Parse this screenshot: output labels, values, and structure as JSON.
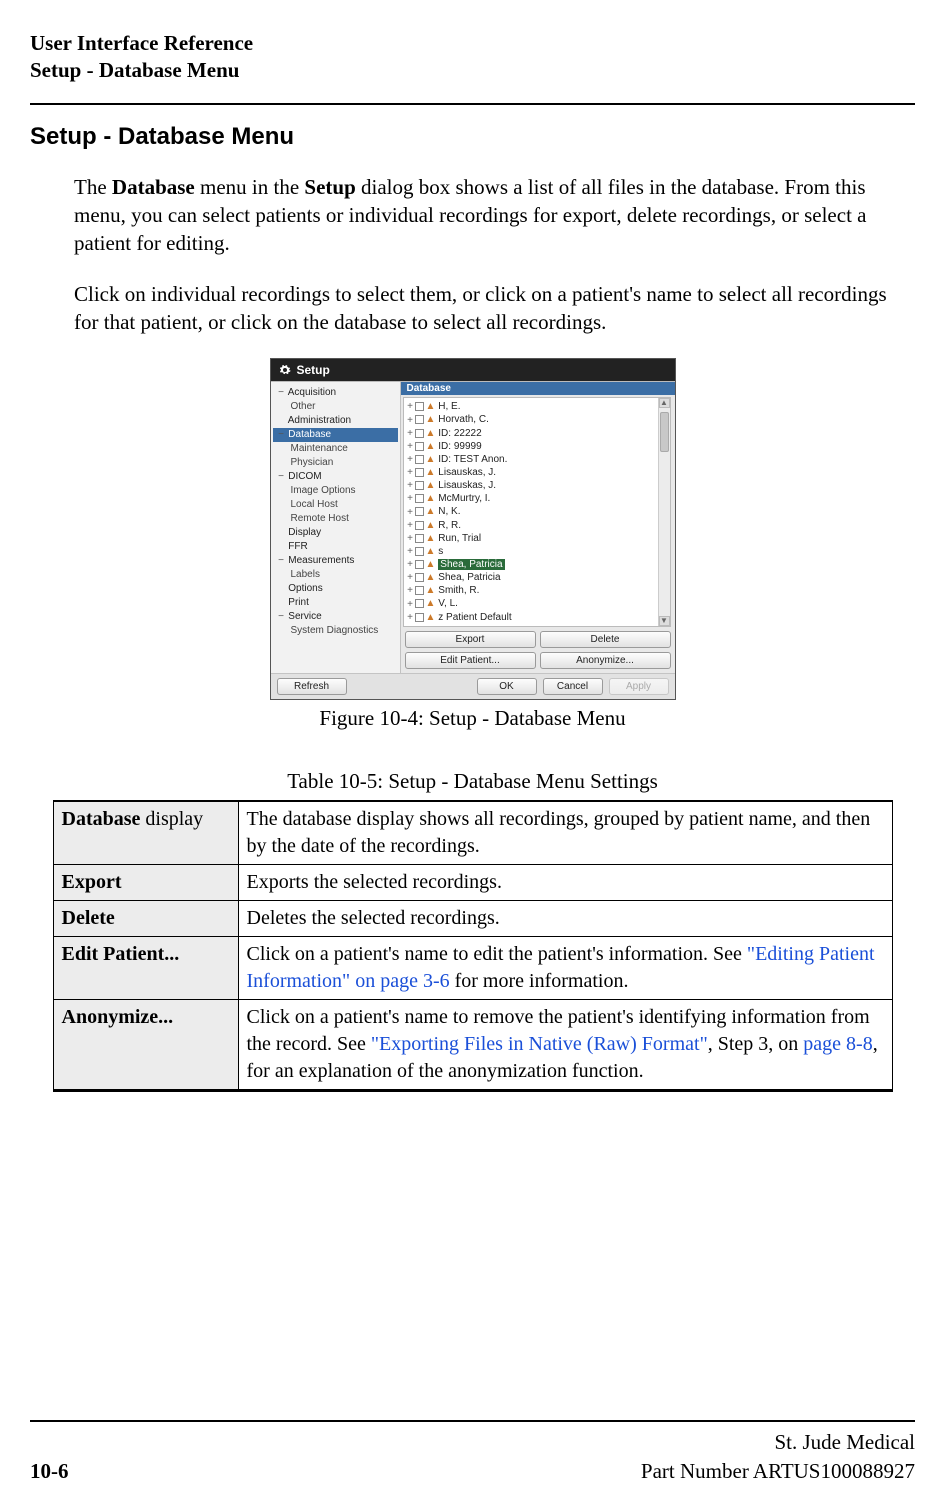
{
  "header": {
    "line1": "User Interface Reference",
    "line2": "Setup - Database Menu"
  },
  "h1": "Setup - Database Menu",
  "p1_pre": "The ",
  "p1_b1": "Database",
  "p1_mid": " menu in the ",
  "p1_b2": "Setup",
  "p1_post": " dialog box shows a list of all files in the database. From this menu, you can select patients or individual recordings for export, delete recordings, or select a patient for editing.",
  "p2": "Click on individual recordings to select them, or click on a patient's name to select all recordings for that patient, or click on the database to select all recordings.",
  "figure": {
    "caption": "Figure 10-4:  Setup - Database Menu",
    "dialog": {
      "title": "Setup",
      "nav": {
        "items": [
          {
            "label": "Acquisition",
            "level": 1,
            "exp": "−"
          },
          {
            "label": "Other",
            "level": 2
          },
          {
            "label": "Administration",
            "level": 1
          },
          {
            "label": "Database",
            "level": 1,
            "selected": true,
            "exp": "−"
          },
          {
            "label": "Maintenance",
            "level": 2
          },
          {
            "label": "Physician",
            "level": 2
          },
          {
            "label": "DICOM",
            "level": 1,
            "exp": "−"
          },
          {
            "label": "Image Options",
            "level": 2
          },
          {
            "label": "Local Host",
            "level": 2
          },
          {
            "label": "Remote Host",
            "level": 2
          },
          {
            "label": "Display",
            "level": 1
          },
          {
            "label": "FFR",
            "level": 1
          },
          {
            "label": "Measurements",
            "level": 1,
            "exp": "−"
          },
          {
            "label": "Labels",
            "level": 2
          },
          {
            "label": "Options",
            "level": 1
          },
          {
            "label": "Print",
            "level": 1
          },
          {
            "label": "Service",
            "level": 1,
            "exp": "−"
          },
          {
            "label": "System Diagnostics",
            "level": 2
          }
        ]
      },
      "db": {
        "heading": "Database",
        "patients": [
          "H, E.",
          "Horvath, C.",
          "ID: 22222",
          "ID: 99999",
          "ID: TEST Anon.",
          "Lisauskas, J.",
          "Lisauskas, J.",
          "McMurtry, I.",
          "N, K.",
          "R, R.",
          "Run, Trial",
          "s",
          "Shea, Patricia",
          "Shea, Patricia",
          "Smith, R.",
          "V, L.",
          "z Patient Default"
        ],
        "selected_index": 12
      },
      "actions": {
        "export": "Export",
        "delete": "Delete",
        "edit_patient": "Edit Patient...",
        "anonymize": "Anonymize..."
      },
      "footer": {
        "refresh": "Refresh",
        "ok": "OK",
        "cancel": "Cancel",
        "apply": "Apply"
      }
    }
  },
  "table": {
    "title": "Table 10-5:  Setup - Database Menu Settings",
    "rows": [
      {
        "key_bold": "Database",
        "key_plain": " display",
        "val": "The database display shows all recordings, grouped by patient name, and then by the date of the recordings."
      },
      {
        "key_bold": "Export",
        "key_plain": "",
        "val": "Exports the selected recordings."
      },
      {
        "key_bold": "Delete",
        "key_plain": "",
        "val": "Deletes the selected recordings."
      },
      {
        "key_bold": "Edit Patient...",
        "key_plain": "",
        "val_pre": "Click on a patient's name to edit the patient's information.  See ",
        "val_link1": "\"Editing Patient Information\" on page 3-6",
        "val_post": " for more information."
      },
      {
        "key_bold": "Anonymize...",
        "key_plain": "",
        "val_pre": "Click on a patient's name to remove the patient's identifying information from the record.  See ",
        "val_link1": "\"Exporting Files in Native (Raw) Format\"",
        "val_mid": ", Step 3, on ",
        "val_link2": "page 8-8",
        "val_post": ", for an explanation of the anonymization function."
      }
    ]
  },
  "footer": {
    "page_number": "10-6",
    "company": "St. Jude Medical",
    "part": "Part Number ARTUS100088927"
  }
}
